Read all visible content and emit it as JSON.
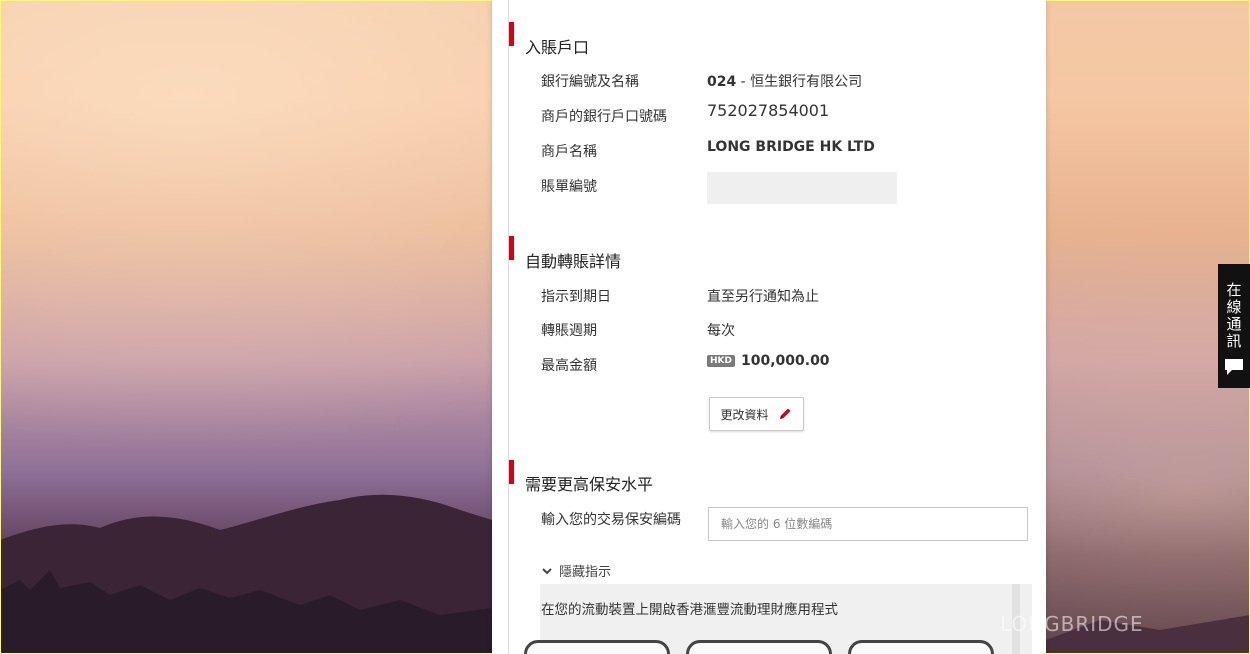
{
  "account_section": {
    "title": "入賬戶口",
    "rows": [
      {
        "label": "銀行編號及名稱",
        "value_prefix": "024",
        "value_rest": " - 恒生銀行有限公司"
      },
      {
        "label": "商戶的銀行戶口號碼",
        "value": "752027854001"
      },
      {
        "label": "商戶名稱",
        "value": "LONG BRIDGE HK LTD"
      },
      {
        "label": "賬單編號",
        "value": ""
      }
    ]
  },
  "transfer_section": {
    "title": "自動轉賬詳情",
    "rows": [
      {
        "label": "指示到期日",
        "value": "直至另行通知為止"
      },
      {
        "label": "轉賬週期",
        "value": "每次"
      },
      {
        "label": "最高金額",
        "currency": "HKD",
        "value": "100,000.00"
      }
    ],
    "edit_button": "更改資料"
  },
  "security_section": {
    "title": "需要更高保安水平",
    "input_label": "輸入您的交易保安編碼",
    "input_placeholder": "輸入您的 6 位數編碼",
    "hide_toggle": "隱藏指示",
    "instruction": "在您的流動裝置上開啟香港滙豐流動理財應用程式"
  },
  "chat_tab": {
    "label": "在線通訊"
  },
  "watermark": "LONGBRIDGE",
  "colors": {
    "accent_red": "#db0011",
    "chat_bg": "#111111"
  }
}
